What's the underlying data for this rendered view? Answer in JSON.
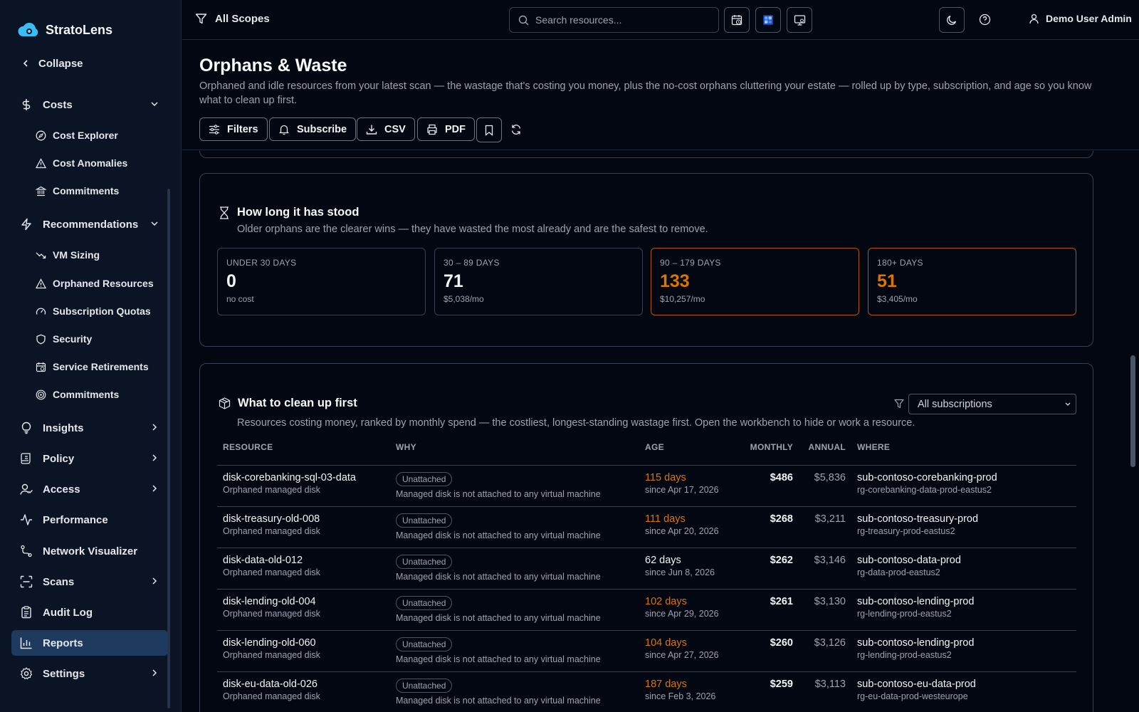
{
  "brand": {
    "name": "StratoLens"
  },
  "sidebar": {
    "collapse_label": "Collapse",
    "sections": {
      "costs": "Costs",
      "recommendations": "Recommendations",
      "insights": "Insights",
      "policy": "Policy",
      "access": "Access",
      "performance": "Performance",
      "network": "Network Visualizer",
      "scans": "Scans",
      "audit": "Audit Log",
      "reports": "Reports",
      "settings": "Settings"
    },
    "costs_items": [
      "Cost Explorer",
      "Cost Anomalies",
      "Commitments"
    ],
    "rec_items": [
      "VM Sizing",
      "Orphaned Resources",
      "Subscription Quotas",
      "Security",
      "Service Retirements",
      "Commitments"
    ]
  },
  "topbar": {
    "scopes_label": "All Scopes",
    "search_placeholder": "Search resources...",
    "user_name": "Demo User Admin"
  },
  "page": {
    "title": "Orphans & Waste",
    "subtitle": "Orphaned and idle resources from your latest scan — the wastage that's costing you money, plus the no-cost orphans cluttering your estate — rolled up by type, subscription, and age so you know what to clean up first.",
    "actions": {
      "filters": "Filters",
      "subscribe": "Subscribe",
      "csv": "CSV",
      "pdf": "PDF"
    }
  },
  "age_card": {
    "title": "How long it has stood",
    "subtitle": "Older orphans are the clearer wins — they have wasted the most already and are the safest to remove.",
    "buckets": [
      {
        "label": "UNDER 30 DAYS",
        "count": "0",
        "sub": "no cost"
      },
      {
        "label": "30 – 89 DAYS",
        "count": "71",
        "sub": "$5,038/mo"
      },
      {
        "label": "90 – 179 DAYS",
        "count": "133",
        "sub": "$10,257/mo"
      },
      {
        "label": "180+ DAYS",
        "count": "51",
        "sub": "$3,405/mo"
      }
    ]
  },
  "cleanup_card": {
    "title": "What to clean up first",
    "subtitle": "Resources costing money, ranked by monthly spend — the costliest, longest-standing wastage first. Open the workbench to hide or work a resource.",
    "subscription_filter": "All subscriptions",
    "columns": {
      "resource": "RESOURCE",
      "why": "WHY",
      "age": "AGE",
      "monthly": "MONTHLY",
      "annual": "ANNUAL",
      "where": "WHERE"
    },
    "rows": [
      {
        "name": "disk-corebanking-sql-03-data",
        "type": "Orphaned managed disk",
        "badge": "Unattached",
        "why": "Managed disk is not attached to any virtual machine",
        "age": "115 days",
        "since": "since Apr 17, 2026",
        "monthly": "$486",
        "annual": "$5,836",
        "sub": "sub-contoso-corebanking-prod",
        "rg": "rg-corebanking-data-prod-eastus2"
      },
      {
        "name": "disk-treasury-old-008",
        "type": "Orphaned managed disk",
        "badge": "Unattached",
        "why": "Managed disk is not attached to any virtual machine",
        "age": "111 days",
        "since": "since Apr 20, 2026",
        "monthly": "$268",
        "annual": "$3,211",
        "sub": "sub-contoso-treasury-prod",
        "rg": "rg-treasury-prod-eastus2"
      },
      {
        "name": "disk-data-old-012",
        "type": "Orphaned managed disk",
        "badge": "Unattached",
        "why": "Managed disk is not attached to any virtual machine",
        "age": "62 days",
        "since": "since Jun 8, 2026",
        "monthly": "$262",
        "annual": "$3,146",
        "sub": "sub-contoso-data-prod",
        "rg": "rg-data-prod-eastus2"
      },
      {
        "name": "disk-lending-old-004",
        "type": "Orphaned managed disk",
        "badge": "Unattached",
        "why": "Managed disk is not attached to any virtual machine",
        "age": "102 days",
        "since": "since Apr 29, 2026",
        "monthly": "$261",
        "annual": "$3,130",
        "sub": "sub-contoso-lending-prod",
        "rg": "rg-lending-prod-eastus2"
      },
      {
        "name": "disk-lending-old-060",
        "type": "Orphaned managed disk",
        "badge": "Unattached",
        "why": "Managed disk is not attached to any virtual machine",
        "age": "104 days",
        "since": "since Apr 27, 2026",
        "monthly": "$260",
        "annual": "$3,126",
        "sub": "sub-contoso-lending-prod",
        "rg": "rg-lending-prod-eastus2"
      },
      {
        "name": "disk-eu-data-old-026",
        "type": "Orphaned managed disk",
        "badge": "Unattached",
        "why": "Managed disk is not attached to any virtual machine",
        "age": "187 days",
        "since": "since Feb 3, 2026",
        "monthly": "$259",
        "annual": "$3,113",
        "sub": "sub-contoso-eu-data-prod",
        "rg": "rg-eu-data-prod-westeurope"
      }
    ]
  },
  "colors": {
    "accent": "#38bdf8",
    "warning": "#d97706",
    "active_nav": "#1e3a5f"
  }
}
